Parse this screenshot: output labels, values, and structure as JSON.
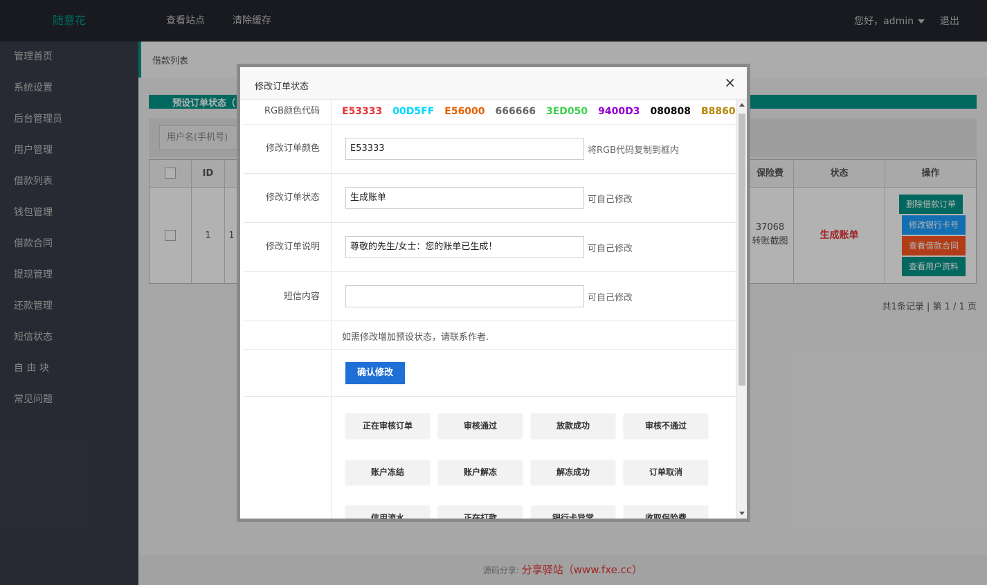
{
  "brand": "随意花",
  "topnav": [
    "查看站点",
    "清除缓存"
  ],
  "user_greeting": "您好，admin",
  "logout": "退出",
  "sidebar": [
    "管理首页",
    "系统设置",
    "后台管理员",
    "用户管理",
    "借款列表",
    "钱包管理",
    "借款合同",
    "提现管理",
    "还款管理",
    "短信状态",
    "自 由 块",
    "常见问题"
  ],
  "breadcrumb": "借款列表",
  "background": {
    "card_title": "预设订单状态（",
    "search_placeholder": "用户名(手机号)",
    "table_headers": {
      "id": "ID",
      "insurance": "保险费",
      "status": "状态",
      "actions": "操作"
    },
    "row": {
      "id": "1",
      "id_partial": "1",
      "insurance_value": "37068",
      "insurance_note": "转账截图",
      "status": "生成账单"
    },
    "actions": [
      {
        "label": "删除借款订单",
        "color": "#009688"
      },
      {
        "label": "修改银行卡号",
        "color": "#1E9FFF"
      },
      {
        "label": "查看借款合同",
        "color": "#FF5722"
      },
      {
        "label": "查看用户资料",
        "color": "#009688"
      }
    ],
    "pager": "共1条记录 | 第 1 / 1 页"
  },
  "footer": {
    "prefix": "源码分享:",
    "site": "分享驿站（www.fxe.cc）"
  },
  "modal": {
    "title": "修改订单状态",
    "close": "×",
    "rgb_label": "RGB颜色代码",
    "rgb_codes": [
      {
        "code": "E53333",
        "color": "#E53333"
      },
      {
        "code": "00D5FF",
        "color": "#00D5FF"
      },
      {
        "code": "E56000",
        "color": "#E56000"
      },
      {
        "code": "666666",
        "color": "#666666"
      },
      {
        "code": "3ED050",
        "color": "#3ED050"
      },
      {
        "code": "9400D3",
        "color": "#9400D3"
      },
      {
        "code": "080808",
        "color": "#080808"
      },
      {
        "code": "B8860B",
        "color": "#B8860B"
      }
    ],
    "color_label": "修改订单颜色",
    "color_value": "E53333",
    "color_hint": "将RGB代码复制到框内",
    "status_label": "修改订单状态",
    "status_value": "生成账单",
    "status_hint": "可自己修改",
    "desc_label": "修改订单说明",
    "desc_value": "尊敬的先生/女士：您的账单已生成！",
    "desc_hint": "可自己修改",
    "sms_label": "短信内容",
    "sms_value": "",
    "sms_hint": "可自己修改",
    "note": "如需修改增加预设状态，请联系作者.",
    "confirm": "确认修改",
    "presets": [
      "正在审核订单",
      "审核通过",
      "放款成功",
      "审核不通过",
      "账户冻结",
      "账户解冻",
      "解冻成功",
      "订单取消",
      "信用流水",
      "正在打款",
      "银行卡异常",
      "收取保险费"
    ]
  }
}
